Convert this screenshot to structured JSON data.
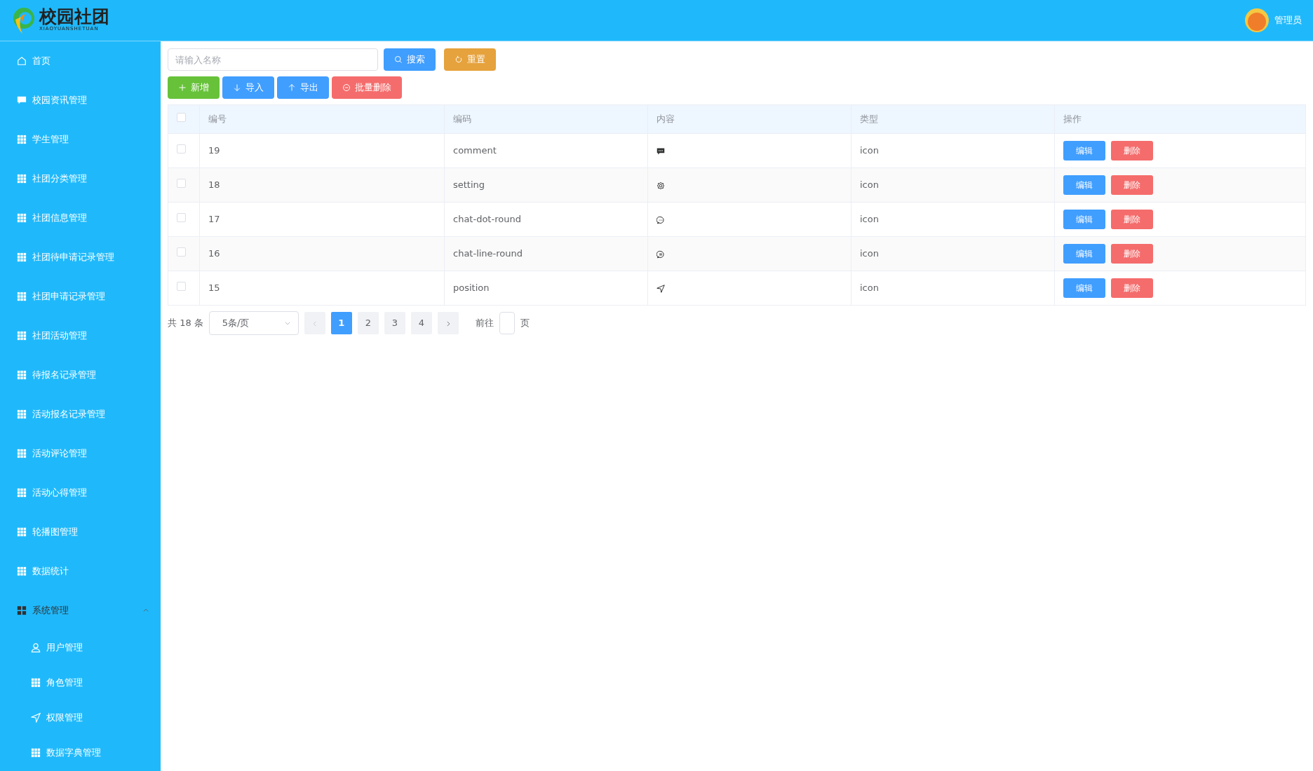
{
  "header": {
    "logo_title": "校园社团",
    "logo_subtitle": "XIAOYUANSHETUAN",
    "user": "管理员"
  },
  "sidebar": {
    "items": [
      {
        "label": "首页",
        "kind": "home"
      },
      {
        "label": "校园资讯管理",
        "kind": "chat"
      },
      {
        "label": "学生管理",
        "kind": "grid"
      },
      {
        "label": "社团分类管理",
        "kind": "grid"
      },
      {
        "label": "社团信息管理",
        "kind": "grid"
      },
      {
        "label": "社团待申请记录管理",
        "kind": "grid"
      },
      {
        "label": "社团申请记录管理",
        "kind": "grid"
      },
      {
        "label": "社团活动管理",
        "kind": "grid"
      },
      {
        "label": "待报名记录管理",
        "kind": "grid"
      },
      {
        "label": "活动报名记录管理",
        "kind": "grid"
      },
      {
        "label": "活动评论管理",
        "kind": "grid"
      },
      {
        "label": "活动心得管理",
        "kind": "grid"
      },
      {
        "label": "轮播图管理",
        "kind": "grid"
      },
      {
        "label": "数据统计",
        "kind": "grid"
      },
      {
        "label": "系统管理",
        "kind": "group",
        "expanded": true,
        "children": [
          {
            "label": "用户管理",
            "kind": "user"
          },
          {
            "label": "角色管理",
            "kind": "grid"
          },
          {
            "label": "权限管理",
            "kind": "send"
          },
          {
            "label": "数据字典管理",
            "kind": "grid"
          }
        ]
      }
    ]
  },
  "search": {
    "placeholder": "请输入名称",
    "buttons": [
      {
        "label": "搜索",
        "kind": "search"
      },
      {
        "label": "重置",
        "kind": "reset"
      }
    ]
  },
  "toolbar": [
    {
      "label": "新增",
      "kind": "add"
    },
    {
      "label": "导入",
      "kind": "import"
    },
    {
      "label": "导出",
      "kind": "export"
    },
    {
      "label": "批量删除",
      "kind": "delete"
    }
  ],
  "table": {
    "select_all": {
      "checked": false
    },
    "columns": [
      "编号",
      "编码",
      "内容",
      "类型",
      "操作"
    ],
    "rows": [
      {
        "checked": false,
        "id": "19",
        "code": "comment",
        "kind": "comment",
        "type": "icon",
        "actions": [
          "编辑",
          "删除"
        ]
      },
      {
        "checked": false,
        "id": "18",
        "code": "setting",
        "kind": "setting",
        "type": "icon",
        "actions": [
          "编辑",
          "删除"
        ]
      },
      {
        "checked": false,
        "id": "17",
        "code": "chat-dot-round",
        "kind": "chatdot",
        "type": "icon",
        "actions": [
          "编辑",
          "删除"
        ]
      },
      {
        "checked": false,
        "id": "16",
        "code": "chat-line-round",
        "kind": "chatline",
        "type": "icon",
        "actions": [
          "编辑",
          "删除"
        ]
      },
      {
        "checked": false,
        "id": "15",
        "code": "position",
        "kind": "position",
        "type": "icon",
        "actions": [
          "编辑",
          "删除"
        ]
      }
    ]
  },
  "pagination": {
    "total": "共 18 条",
    "page_size": "5条/页",
    "pages": [
      {
        "label": "1",
        "selected": true
      },
      {
        "label": "2",
        "selected": false
      },
      {
        "label": "3",
        "selected": false
      },
      {
        "label": "4",
        "selected": false
      }
    ],
    "goto_label": "前往",
    "goto_suffix": "页"
  }
}
